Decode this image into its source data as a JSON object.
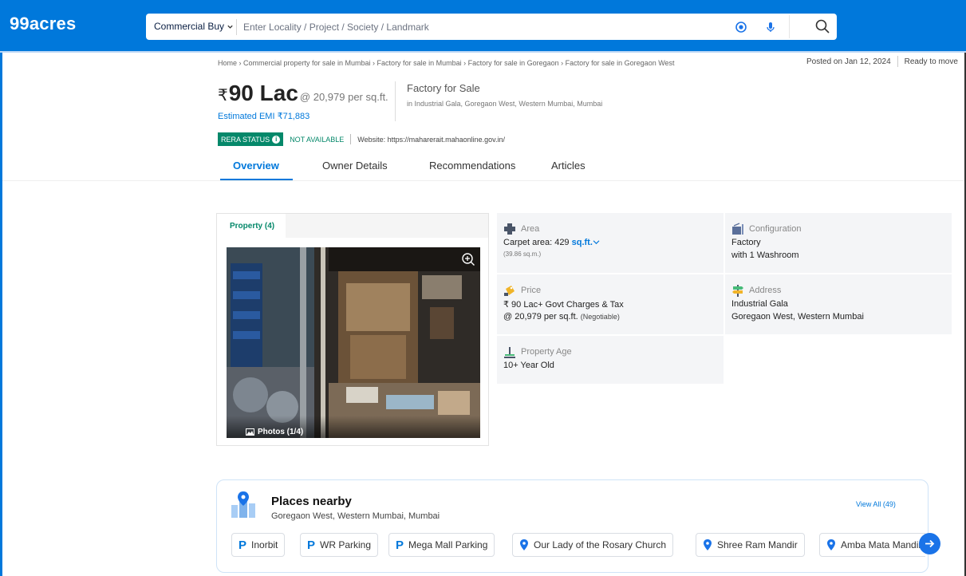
{
  "header": {
    "logo": "99acres",
    "search_type": "Commercial Buy",
    "search_placeholder": "Enter Locality / Project / Society / Landmark",
    "brand_color": "#0078DB"
  },
  "breadcrumbs": "Home › Commercial property for sale in Mumbai › Factory for sale in Mumbai › Factory for sale in Goregaon › Factory for sale in Goregaon West",
  "posted": "Posted on Jan 12, 2024",
  "status": "Ready to move",
  "price": {
    "currency": "₹",
    "amount": "90 Lac",
    "per_sqft": "@ 20,979 per sq.ft.",
    "emi": "Estimated EMI ₹71,883"
  },
  "property_type": "Factory for Sale",
  "location": "in Industrial Gala, Goregaon West, Western Mumbai, Mumbai",
  "rera": {
    "label": "RERA STATUS",
    "value": "NOT AVAILABLE",
    "website": "Website: https://maharerait.mahaonline.gov.in/"
  },
  "tabs": [
    {
      "label": "Overview",
      "active": true
    },
    {
      "label": "Owner Details"
    },
    {
      "label": "Recommendations"
    },
    {
      "label": "Articles"
    }
  ],
  "gallery": {
    "tab_label": "Property (4)",
    "photos_label": "Photos (1/4)"
  },
  "details": {
    "area": {
      "label": "Area",
      "value": "Carpet area: 429",
      "unit": "sq.ft.",
      "sub": "(39.86 sq.m.)"
    },
    "configuration": {
      "label": "Configuration",
      "line1": "Factory",
      "line2": "with 1 Washroom"
    },
    "price": {
      "label": "Price",
      "line1": "₹ 90 Lac+ Govt Charges & Tax",
      "line2": "@ 20,979 per sq.ft.",
      "note": "(Negotiable)"
    },
    "address": {
      "label": "Address",
      "line1": "Industrial Gala",
      "line2": "Goregaon West, Western Mumbai"
    },
    "age": {
      "label": "Property Age",
      "value": "10+ Year Old"
    }
  },
  "nearby": {
    "title": "Places nearby",
    "subtitle": "Goregaon West, Western Mumbai, Mumbai",
    "view_all": "View All (49)",
    "places": [
      {
        "name": "Inorbit",
        "icon": "parking-icon"
      },
      {
        "name": "WR Parking",
        "icon": "parking-icon"
      },
      {
        "name": "Mega Mall Parking",
        "icon": "parking-icon"
      },
      {
        "name": "Our Lady of the Rosary Church",
        "icon": "location-pin-icon"
      },
      {
        "name": "Shree Ram Mandir",
        "icon": "location-pin-icon"
      },
      {
        "name": "Amba Mata Mandir",
        "icon": "location-pin-icon"
      }
    ]
  }
}
